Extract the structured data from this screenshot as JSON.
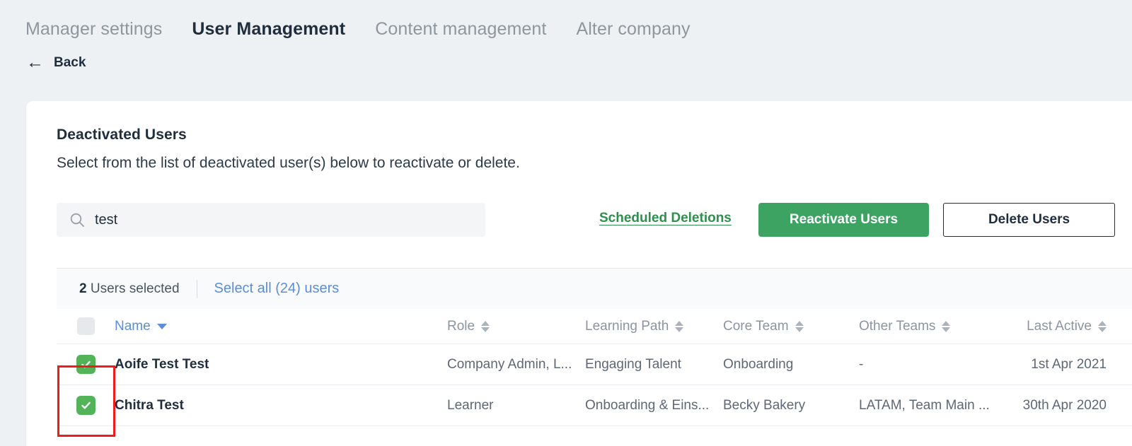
{
  "tabs": [
    {
      "label": "Manager settings",
      "active": false
    },
    {
      "label": "User Management",
      "active": true
    },
    {
      "label": "Content management",
      "active": false
    },
    {
      "label": "Alter company",
      "active": false
    }
  ],
  "back": {
    "label": "Back",
    "icon": "arrow-left-icon",
    "glyph": "←"
  },
  "panel": {
    "title": "Deactivated Users",
    "subtitle": "Select from the list of deactivated user(s) below to reactivate or delete."
  },
  "search": {
    "value": "test",
    "placeholder": "Search",
    "icon": "search-icon"
  },
  "actions": {
    "scheduled_deletions": "Scheduled Deletions",
    "reactivate_users": "Reactivate Users",
    "delete_users": "Delete Users"
  },
  "selection": {
    "count": "2",
    "count_label": " Users selected",
    "select_all": "Select all (24) users"
  },
  "table": {
    "columns": [
      {
        "label": "Name",
        "sort": "desc",
        "active": true
      },
      {
        "label": "Role",
        "sort": "none",
        "active": false
      },
      {
        "label": "Learning Path",
        "sort": "none",
        "active": false
      },
      {
        "label": "Core Team",
        "sort": "none",
        "active": false
      },
      {
        "label": "Other Teams",
        "sort": "none",
        "active": false
      },
      {
        "label": "Last Active",
        "sort": "none",
        "active": false
      }
    ],
    "rows": [
      {
        "checked": true,
        "name": "Aoife Test Test",
        "role": "Company Admin, L...",
        "learning_path": "Engaging Talent",
        "core_team": "Onboarding",
        "other_teams": "-",
        "last_active": "1st Apr 2021"
      },
      {
        "checked": true,
        "name": "Chitra Test",
        "role": "Learner",
        "learning_path": "Onboarding & Eins...",
        "core_team": "Becky Bakery",
        "other_teams": "LATAM, Team Main ...",
        "last_active": "30th Apr 2020"
      }
    ]
  },
  "colors": {
    "page_bg": "#eef1f4",
    "primary_green": "#3da362",
    "link_blue": "#5b8dd9",
    "checkbox_green": "#52b359",
    "annotation_red": "#ef1c1c",
    "text_dark": "#1f2d3d"
  }
}
